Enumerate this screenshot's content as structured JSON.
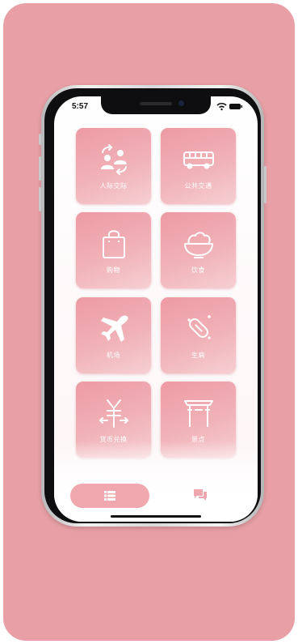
{
  "status_bar": {
    "time": "5:57"
  },
  "tiles": [
    {
      "label": "人际交际",
      "icon": "people-exchange-icon"
    },
    {
      "label": "公共交通",
      "icon": "bus-icon"
    },
    {
      "label": "购物",
      "icon": "shopping-bag-icon"
    },
    {
      "label": "饮食",
      "icon": "rice-bowl-icon"
    },
    {
      "label": "机场",
      "icon": "airplane-icon"
    },
    {
      "label": "生病",
      "icon": "pill-icon"
    },
    {
      "label": "货币兑换",
      "icon": "yen-exchange-icon"
    },
    {
      "label": "景点",
      "icon": "gate-icon"
    }
  ],
  "tab_bar": {
    "items": [
      {
        "icon": "list-icon",
        "active": true
      },
      {
        "icon": "chat-icon",
        "active": false
      }
    ]
  },
  "colors": {
    "background": "#e8a0a6",
    "tile": "#ee9aa3",
    "tab_active": "#f0a7ae",
    "icon": "#ffffff"
  }
}
